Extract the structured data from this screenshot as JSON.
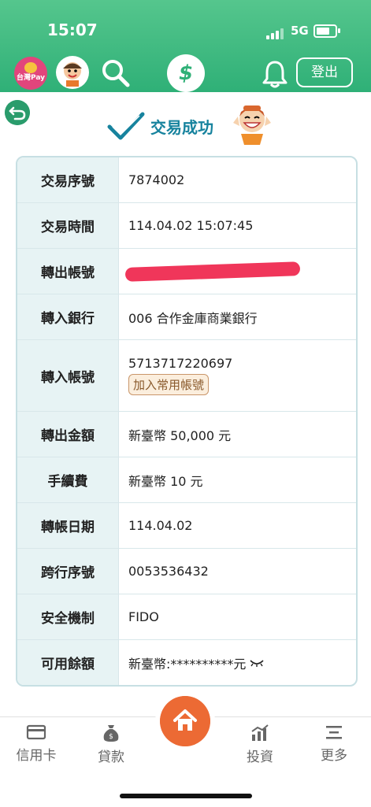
{
  "status_bar": {
    "time": "15:07",
    "network": "5G"
  },
  "header": {
    "pay_label": "台灣Pay",
    "logo_text": "$",
    "logout_label": "登出"
  },
  "title": {
    "text": "交易成功"
  },
  "rows": [
    {
      "label": "交易序號",
      "value": "7874002"
    },
    {
      "label": "交易時間",
      "value": "114.04.02 15:07:45"
    },
    {
      "label": "轉出帳號",
      "value": ""
    },
    {
      "label": "轉入銀行",
      "value": "006 合作金庫商業銀行"
    },
    {
      "label": "轉入帳號",
      "value": "5713717220697",
      "button": "加入常用帳號"
    },
    {
      "label": "轉出金額",
      "value": "新臺幣 50,000 元"
    },
    {
      "label": "手續費",
      "value": "新臺幣 10 元"
    },
    {
      "label": "轉帳日期",
      "value": "114.04.02"
    },
    {
      "label": "跨行序號",
      "value": "0053536432"
    },
    {
      "label": "安全機制",
      "value": "FIDO"
    },
    {
      "label": "可用餘額",
      "value": "新臺幣:**********元"
    }
  ],
  "tabbar": {
    "credit_card": "信用卡",
    "loan": "貸款",
    "invest": "投資",
    "more": "更多"
  },
  "colors": {
    "header_green": "#2fb077",
    "accent_teal": "#17839e",
    "home_orange": "#ec6a34",
    "redact_red": "#f0365a"
  }
}
